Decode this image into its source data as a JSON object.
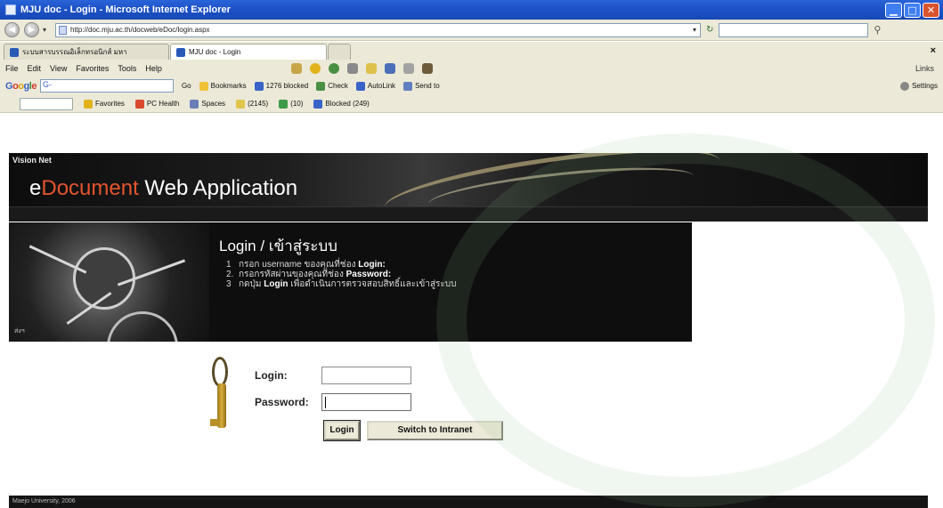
{
  "browser": {
    "window_title": "MJU doc - Login - Microsoft Internet Explorer",
    "url": "http://doc.mju.ac.th/docweb/eDoc/login.aspx",
    "tabs": [
      {
        "label": "ระบบสารบรรณอิเล็กทรอนิกส์ มหา"
      },
      {
        "label": "MJU doc - Login"
      }
    ],
    "menu": [
      "File",
      "Edit",
      "View",
      "Favorites",
      "Tools",
      "Help"
    ],
    "links_label": "Links",
    "google_bar": {
      "logo": "Google",
      "search_value": "G-",
      "go_label": "Go",
      "bookmarks": "Bookmarks",
      "blocked": "1276 blocked",
      "check": "Check",
      "autolink": "AutoLink",
      "send_to": "Send to",
      "settings": "Settings"
    },
    "msn_bar": {
      "favorites": "Favorites",
      "pc_health": "PC Health",
      "spaces": "Spaces",
      "count_a": "(2145)",
      "count_b": "(10)",
      "blocked": "Blocked (249)"
    }
  },
  "page": {
    "logo_text": "Vision Net",
    "app_title_e": "e",
    "app_title_accent": "Document",
    "app_title_rest": " Web Application",
    "login_title": "Login / เข้าสู่ระบบ",
    "steps": [
      {
        "num": "1",
        "pre": "กรอก username ของคุณที่ช่อง ",
        "bold": "Login:"
      },
      {
        "num": "2.",
        "pre": "กรอกรหัสผ่านของคุณที่ช่อง ",
        "bold": "Password:"
      },
      {
        "num": "3",
        "pre": "กดปุ่ม ",
        "bold": "Login",
        "post": " เพื่อดำเนินการตรวจสอบสิทธิ์และเข้าสู่ระบบ"
      }
    ],
    "art_caption": "ส่งฯ",
    "form": {
      "login_label": "Login:",
      "password_label": "Password:",
      "login_value": "",
      "password_value": "",
      "login_button": "Login",
      "switch_button": "Switch to Intranet"
    },
    "footer": "Maejo University, 2006"
  },
  "colors": {
    "title_bar": "#1d52c8",
    "banner_accent": "#e3552e",
    "banner_bg": "#0d0d0d"
  }
}
